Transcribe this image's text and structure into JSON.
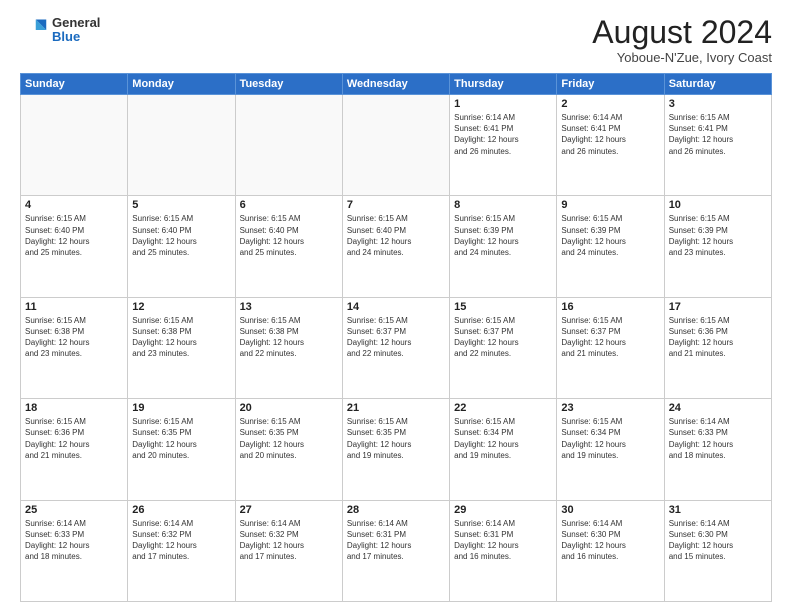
{
  "header": {
    "logo": {
      "general": "General",
      "blue": "Blue"
    },
    "title": "August 2024",
    "location": "Yoboue-N'Zue, Ivory Coast"
  },
  "weekdays": [
    "Sunday",
    "Monday",
    "Tuesday",
    "Wednesday",
    "Thursday",
    "Friday",
    "Saturday"
  ],
  "weeks": [
    [
      {
        "day": "",
        "info": ""
      },
      {
        "day": "",
        "info": ""
      },
      {
        "day": "",
        "info": ""
      },
      {
        "day": "",
        "info": ""
      },
      {
        "day": "1",
        "info": "Sunrise: 6:14 AM\nSunset: 6:41 PM\nDaylight: 12 hours\nand 26 minutes."
      },
      {
        "day": "2",
        "info": "Sunrise: 6:14 AM\nSunset: 6:41 PM\nDaylight: 12 hours\nand 26 minutes."
      },
      {
        "day": "3",
        "info": "Sunrise: 6:15 AM\nSunset: 6:41 PM\nDaylight: 12 hours\nand 26 minutes."
      }
    ],
    [
      {
        "day": "4",
        "info": "Sunrise: 6:15 AM\nSunset: 6:40 PM\nDaylight: 12 hours\nand 25 minutes."
      },
      {
        "day": "5",
        "info": "Sunrise: 6:15 AM\nSunset: 6:40 PM\nDaylight: 12 hours\nand 25 minutes."
      },
      {
        "day": "6",
        "info": "Sunrise: 6:15 AM\nSunset: 6:40 PM\nDaylight: 12 hours\nand 25 minutes."
      },
      {
        "day": "7",
        "info": "Sunrise: 6:15 AM\nSunset: 6:40 PM\nDaylight: 12 hours\nand 24 minutes."
      },
      {
        "day": "8",
        "info": "Sunrise: 6:15 AM\nSunset: 6:39 PM\nDaylight: 12 hours\nand 24 minutes."
      },
      {
        "day": "9",
        "info": "Sunrise: 6:15 AM\nSunset: 6:39 PM\nDaylight: 12 hours\nand 24 minutes."
      },
      {
        "day": "10",
        "info": "Sunrise: 6:15 AM\nSunset: 6:39 PM\nDaylight: 12 hours\nand 23 minutes."
      }
    ],
    [
      {
        "day": "11",
        "info": "Sunrise: 6:15 AM\nSunset: 6:38 PM\nDaylight: 12 hours\nand 23 minutes."
      },
      {
        "day": "12",
        "info": "Sunrise: 6:15 AM\nSunset: 6:38 PM\nDaylight: 12 hours\nand 23 minutes."
      },
      {
        "day": "13",
        "info": "Sunrise: 6:15 AM\nSunset: 6:38 PM\nDaylight: 12 hours\nand 22 minutes."
      },
      {
        "day": "14",
        "info": "Sunrise: 6:15 AM\nSunset: 6:37 PM\nDaylight: 12 hours\nand 22 minutes."
      },
      {
        "day": "15",
        "info": "Sunrise: 6:15 AM\nSunset: 6:37 PM\nDaylight: 12 hours\nand 22 minutes."
      },
      {
        "day": "16",
        "info": "Sunrise: 6:15 AM\nSunset: 6:37 PM\nDaylight: 12 hours\nand 21 minutes."
      },
      {
        "day": "17",
        "info": "Sunrise: 6:15 AM\nSunset: 6:36 PM\nDaylight: 12 hours\nand 21 minutes."
      }
    ],
    [
      {
        "day": "18",
        "info": "Sunrise: 6:15 AM\nSunset: 6:36 PM\nDaylight: 12 hours\nand 21 minutes."
      },
      {
        "day": "19",
        "info": "Sunrise: 6:15 AM\nSunset: 6:35 PM\nDaylight: 12 hours\nand 20 minutes."
      },
      {
        "day": "20",
        "info": "Sunrise: 6:15 AM\nSunset: 6:35 PM\nDaylight: 12 hours\nand 20 minutes."
      },
      {
        "day": "21",
        "info": "Sunrise: 6:15 AM\nSunset: 6:35 PM\nDaylight: 12 hours\nand 19 minutes."
      },
      {
        "day": "22",
        "info": "Sunrise: 6:15 AM\nSunset: 6:34 PM\nDaylight: 12 hours\nand 19 minutes."
      },
      {
        "day": "23",
        "info": "Sunrise: 6:15 AM\nSunset: 6:34 PM\nDaylight: 12 hours\nand 19 minutes."
      },
      {
        "day": "24",
        "info": "Sunrise: 6:14 AM\nSunset: 6:33 PM\nDaylight: 12 hours\nand 18 minutes."
      }
    ],
    [
      {
        "day": "25",
        "info": "Sunrise: 6:14 AM\nSunset: 6:33 PM\nDaylight: 12 hours\nand 18 minutes."
      },
      {
        "day": "26",
        "info": "Sunrise: 6:14 AM\nSunset: 6:32 PM\nDaylight: 12 hours\nand 17 minutes."
      },
      {
        "day": "27",
        "info": "Sunrise: 6:14 AM\nSunset: 6:32 PM\nDaylight: 12 hours\nand 17 minutes."
      },
      {
        "day": "28",
        "info": "Sunrise: 6:14 AM\nSunset: 6:31 PM\nDaylight: 12 hours\nand 17 minutes."
      },
      {
        "day": "29",
        "info": "Sunrise: 6:14 AM\nSunset: 6:31 PM\nDaylight: 12 hours\nand 16 minutes."
      },
      {
        "day": "30",
        "info": "Sunrise: 6:14 AM\nSunset: 6:30 PM\nDaylight: 12 hours\nand 16 minutes."
      },
      {
        "day": "31",
        "info": "Sunrise: 6:14 AM\nSunset: 6:30 PM\nDaylight: 12 hours\nand 15 minutes."
      }
    ]
  ]
}
